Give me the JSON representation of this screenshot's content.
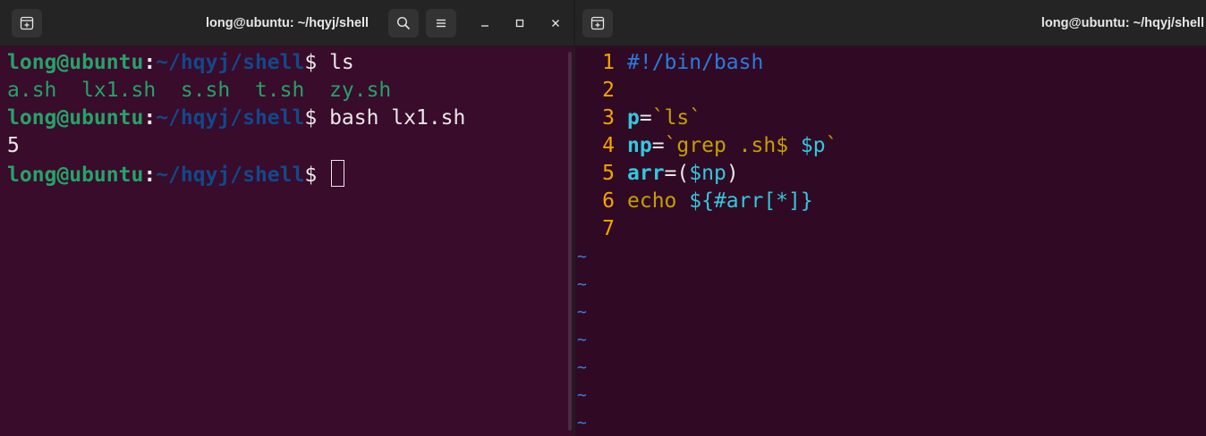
{
  "left_window": {
    "title": "long@ubuntu: ~/hqyj/shell",
    "controls": {
      "minimize": "–",
      "maximize": "□",
      "close": "×"
    },
    "lines": [
      {
        "user": "long@ubuntu",
        "sep": ":",
        "path": "~/hqyj/shell",
        "dollar": "$ ",
        "cmd": "ls"
      },
      {
        "files": "a.sh  lx1.sh  s.sh  t.sh  zy.sh"
      },
      {
        "user": "long@ubuntu",
        "sep": ":",
        "path": "~/hqyj/shell",
        "dollar": "$ ",
        "cmd": "bash lx1.sh"
      },
      {
        "output": "5"
      },
      {
        "user": "long@ubuntu",
        "sep": ":",
        "path": "~/hqyj/shell",
        "dollar": "$ ",
        "cmd": ""
      }
    ]
  },
  "right_window": {
    "title": "long@ubuntu: ~/hqyj/shell",
    "vim": {
      "line_numbers": [
        "1",
        "2",
        "3",
        "4",
        "5",
        "6",
        "7"
      ],
      "l1": "#!/bin/bash",
      "l3": {
        "var": "p",
        "eq": "=",
        "val": "`ls`"
      },
      "l4": {
        "var": "np",
        "eq": "=",
        "q1": "`",
        "cmd": "grep .sh$ ",
        "ref": "$p",
        "q2": "`"
      },
      "l5": {
        "var": "arr",
        "eq": "=",
        "open": "(",
        "ref": "$np",
        "close": ")"
      },
      "l6": {
        "cmd": "echo ",
        "expr": "${#arr[*]}"
      },
      "tilde": "~"
    }
  },
  "colors": {
    "background": "#300a24",
    "prompt_user": "#26a269",
    "prompt_path": "#12488b",
    "line_number": "#f5a300",
    "tilde": "#3584e4"
  }
}
